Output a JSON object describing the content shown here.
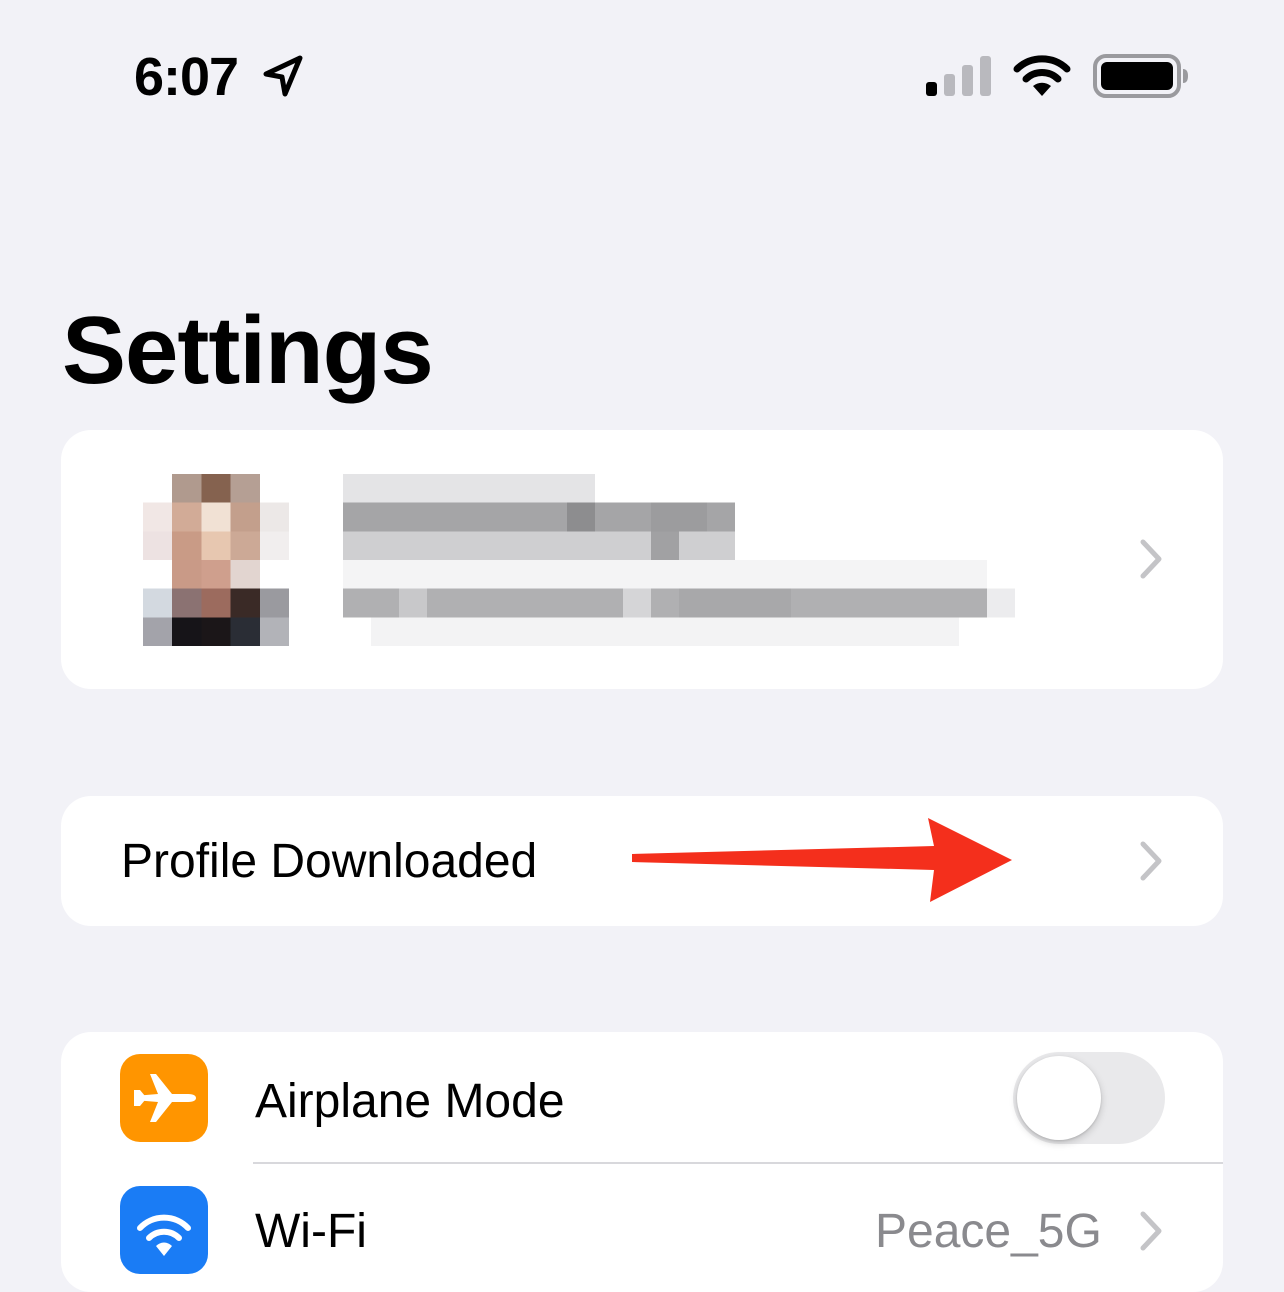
{
  "status_bar": {
    "time": "6:07",
    "location_icon": "location-arrow-icon",
    "signal_icon": "cellular-signal-icon",
    "wifi_icon": "wifi-icon",
    "battery_icon": "battery-icon",
    "signal_bars_active": 1,
    "signal_bars_total": 4
  },
  "header": {
    "title": "Settings"
  },
  "account_card": {
    "avatar_icon": "avatar-pixelated",
    "chevron_icon": "chevron-right-icon"
  },
  "profile_row": {
    "label": "Profile Downloaded",
    "chevron_icon": "chevron-right-icon"
  },
  "settings_list": [
    {
      "label": "Airplane Mode",
      "icon": "airplane-icon",
      "icon_color": "#ff9500",
      "toggle_on": false
    },
    {
      "label": "Wi-Fi",
      "icon": "wifi-icon",
      "icon_color": "#1a7cf5",
      "value": "Peace_5G"
    }
  ],
  "colors": {
    "background": "#f2f2f7",
    "card": "#ffffff",
    "chevron": "#c4c4c7",
    "annotation_arrow": "#f42f1c"
  }
}
